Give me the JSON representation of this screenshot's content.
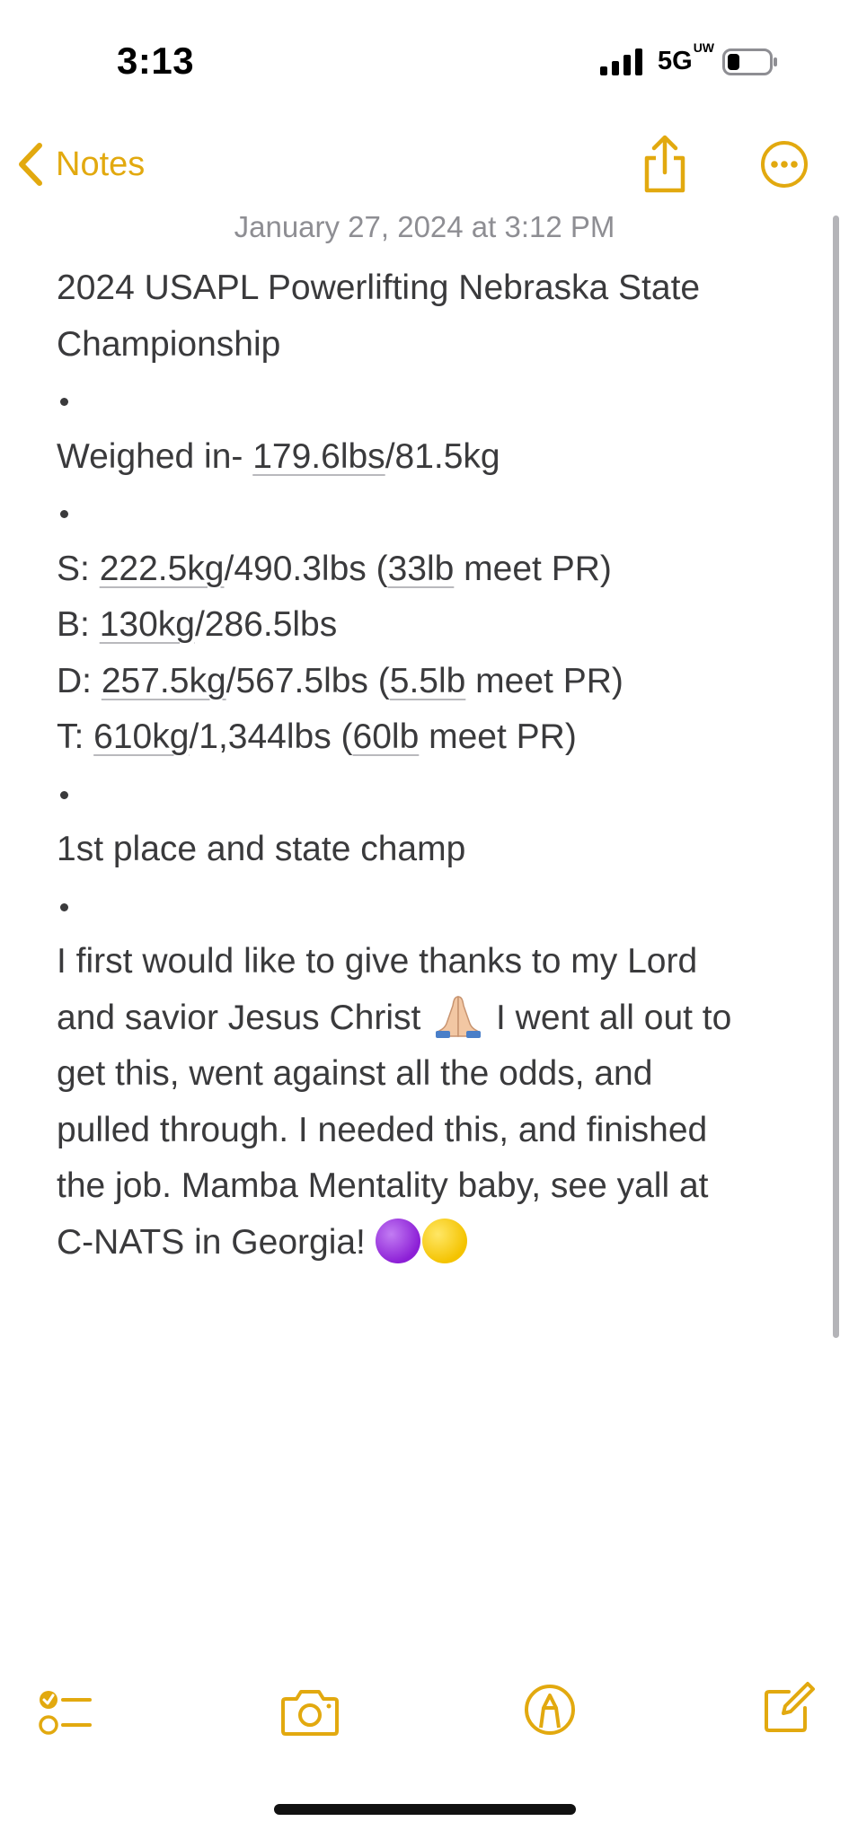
{
  "status": {
    "time": "3:13",
    "network": "5G",
    "network_sup": "UW"
  },
  "nav": {
    "back_label": "Notes",
    "accent_color": "#e2a90f"
  },
  "note": {
    "date": "January 27, 2024 at 3:12 PM",
    "title_line1": "2024 USAPL Powerlifting Nebraska State",
    "title_line2": "Championship",
    "weigh_pre": "Weighed in- ",
    "weigh_u1": "179.6lbs",
    "weigh_post": "/81.5kg",
    "squat_pre": "S: ",
    "squat_u1": "222.5kg",
    "squat_mid": "/490.3lbs (",
    "squat_u2": "33lb",
    "squat_post": " meet PR)",
    "bench_pre": "B: ",
    "bench_u1": "130kg",
    "bench_post": "/286.5lbs",
    "dead_pre": "D: ",
    "dead_u1": "257.5kg",
    "dead_mid": "/567.5lbs (",
    "dead_u2": "5.5lb",
    "dead_post": " meet PR)",
    "total_pre": "T: ",
    "total_u1": "610kg",
    "total_mid": "/1,344lbs (",
    "total_u2": "60lb",
    "total_post": " meet PR)",
    "place": "1st place and state champ",
    "para_line1": "I first would like to give thanks to my Lord",
    "para_line2a": "and savior Jesus Christ ",
    "para_line2b": " I went all out to",
    "para_line3": "get this, went against all the odds, and",
    "para_line4": "pulled through. I needed this, and finished",
    "para_line5": "the job. Mamba Mentality baby, see yall at",
    "para_line6": "C-NATS in Georgia! "
  },
  "icons": {
    "back": "chevron-left-icon",
    "share": "share-icon",
    "more": "ellipsis-circle-icon",
    "checklist": "checklist-icon",
    "camera": "camera-icon",
    "markup": "markup-pen-icon",
    "compose": "compose-icon"
  }
}
